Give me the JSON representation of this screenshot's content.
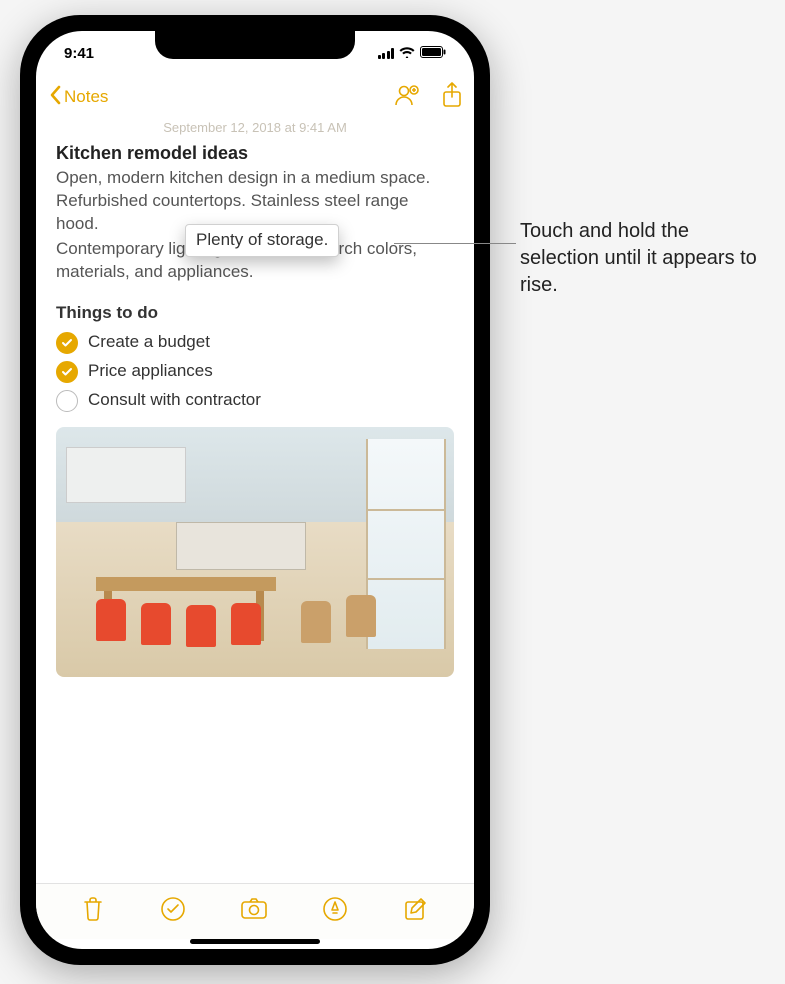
{
  "status": {
    "time": "9:41"
  },
  "nav": {
    "back_label": "Notes"
  },
  "note": {
    "date": "September 12, 2018 at 9:41 AM",
    "title": "Kitchen remodel ideas",
    "body_before": "Open, modern kitchen design in a medium space. Refurbished countertops. Stainless steel range hood.",
    "floating_text": "Plenty of storage.",
    "body_after": "Contemporary lighting. Need to research colors, materials, and appliances.",
    "section_title": "Things to do",
    "checklist": [
      {
        "label": "Create a budget",
        "checked": true
      },
      {
        "label": "Price appliances",
        "checked": true
      },
      {
        "label": "Consult with contractor",
        "checked": false
      }
    ]
  },
  "callout": {
    "text": "Touch and hold the selection until it appears to rise."
  },
  "icons": {
    "back": "chevron-left-icon",
    "collaborate": "person-add-icon",
    "share": "share-icon",
    "trash": "trash-icon",
    "checklist": "checklist-icon",
    "camera": "camera-icon",
    "markup": "markup-icon",
    "compose": "compose-icon"
  }
}
